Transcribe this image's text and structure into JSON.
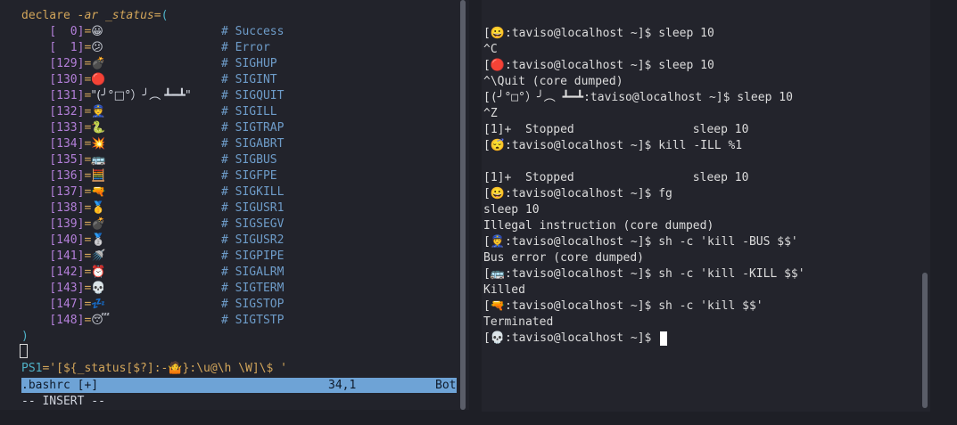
{
  "editor": {
    "declare_kw": "declare",
    "declare_flag": "-ar",
    "declare_var": "_status",
    "open_paren": "(",
    "close_paren": ")",
    "entries": [
      {
        "index": "[  0]",
        "emoji": "😀",
        "comment": "# Success"
      },
      {
        "index": "[  1]",
        "emoji": "😕",
        "comment": "# Error"
      },
      {
        "index": "[129]",
        "emoji": "💣",
        "comment": "# SIGHUP"
      },
      {
        "index": "[130]",
        "emoji": "🔴",
        "comment": "# SIGINT"
      },
      {
        "index": "[131]",
        "emoji": "\"(╯°□°）╯︵ ┻━┻\"",
        "comment": "# SIGQUIT"
      },
      {
        "index": "[132]",
        "emoji": "👮",
        "comment": "# SIGILL"
      },
      {
        "index": "[133]",
        "emoji": "🐍",
        "comment": "# SIGTRAP"
      },
      {
        "index": "[134]",
        "emoji": "💥",
        "comment": "# SIGABRT"
      },
      {
        "index": "[135]",
        "emoji": "🚌",
        "comment": "# SIGBUS"
      },
      {
        "index": "[136]",
        "emoji": "🧮",
        "comment": "# SIGFPE"
      },
      {
        "index": "[137]",
        "emoji": "🔫",
        "comment": "# SIGKILL"
      },
      {
        "index": "[138]",
        "emoji": "🥇",
        "comment": "# SIGUSR1"
      },
      {
        "index": "[139]",
        "emoji": "💣",
        "comment": "# SIGSEGV"
      },
      {
        "index": "[140]",
        "emoji": "🥈",
        "comment": "# SIGUSR2"
      },
      {
        "index": "[141]",
        "emoji": "🚿",
        "comment": "# SIGPIPE"
      },
      {
        "index": "[142]",
        "emoji": "⏰",
        "comment": "# SIGALRM"
      },
      {
        "index": "[143]",
        "emoji": "💀",
        "comment": "# SIGTERM"
      },
      {
        "index": "[147]",
        "emoji": "💤",
        "comment": "# SIGSTOP"
      },
      {
        "index": "[148]",
        "emoji": "😴",
        "comment": "# SIGTSTP"
      }
    ],
    "ps1_name": "PS1",
    "ps1_value": "='[${_status[$?]:-🤷}:\\u@\\h \\W]\\$ '",
    "status_file": ".bashrc [+]",
    "status_pos": "34,1",
    "status_scroll": "Bot",
    "mode": "-- INSERT --"
  },
  "terminal": {
    "lines": [
      "[😀:taviso@localhost ~]$ sleep 10",
      "^C",
      "[🔴:taviso@localhost ~]$ sleep 10",
      "^\\Quit (core dumped)",
      "[(╯°□°）╯︵ ┻━┻:taviso@localhost ~]$ sleep 10",
      "^Z",
      "[1]+  Stopped                 sleep 10",
      "[😴:taviso@localhost ~]$ kill -ILL %1",
      "",
      "[1]+  Stopped                 sleep 10",
      "[😀:taviso@localhost ~]$ fg",
      "sleep 10",
      "Illegal instruction (core dumped)",
      "[👮:taviso@localhost ~]$ sh -c 'kill -BUS $$'",
      "Bus error (core dumped)",
      "[🚌:taviso@localhost ~]$ sh -c 'kill -KILL $$'",
      "Killed",
      "[🔫:taviso@localhost ~]$ sh -c 'kill $$'",
      "Terminated",
      "[💀:taviso@localhost ~]$ "
    ]
  }
}
